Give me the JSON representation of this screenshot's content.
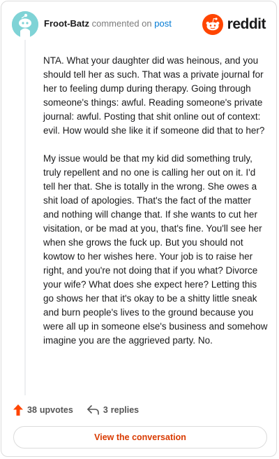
{
  "header": {
    "username": "Froot-Batz",
    "action_text": "commented on",
    "post_link": "post",
    "brand": "reddit"
  },
  "comment": {
    "paragraphs": [
      "NTA. What your daughter did was heinous, and you should tell her as such. That was a private journal for her to feeling dump during therapy. Going through someone's things: awful. Reading someone's private journal: awful. Posting that shit online out of context: evil. How would she like it if someone did that to her?",
      "My issue would be that my kid did something truly, truly repellent and no one is calling her out on it. I'd tell her that. She is totally in the wrong. She owes a shit load of apologies. That's the fact of the matter and nothing will change that. If she wants to cut her visitation, or be mad at you, that's fine. You'll see her when she grows the fuck up. But you should not kowtow to her wishes here. Your job is to raise her right, and you're not doing that if you what? Divorce your wife? What does she expect here? Letting this go shows her that it's okay to be a shitty little sneak and burn people's lives to the ground because you were all up in someone else's business and somehow imagine you are the aggrieved party. No."
    ]
  },
  "actions": {
    "upvote_count": "38",
    "upvote_word": "upvotes",
    "reply_count": "3",
    "reply_word": "replies"
  },
  "footer": {
    "view_button": "View the conversation"
  },
  "colors": {
    "accent": "#ff4500",
    "link": "#0079d3",
    "avatar_bg": "#7fd3d6"
  },
  "icons": [
    "snoo-avatar-icon",
    "reddit-logo-icon",
    "upvote-arrow-icon",
    "reply-arrow-icon"
  ]
}
